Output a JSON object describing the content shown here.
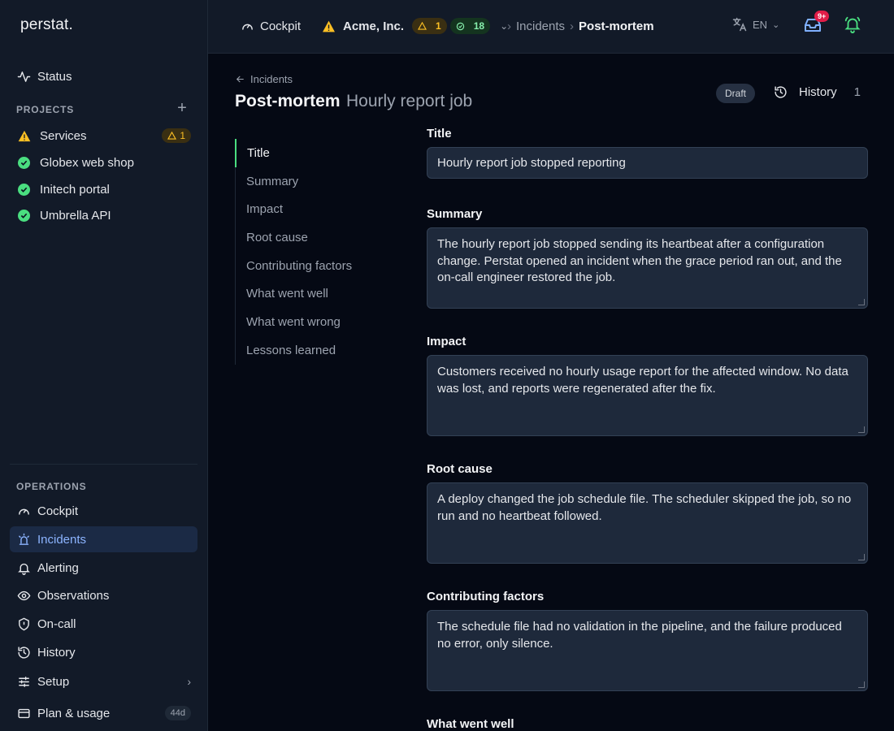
{
  "brand": {
    "logo": "perstat."
  },
  "sidebar": {
    "status_label": "Status",
    "projects_heading": "PROJECTS",
    "projects": [
      {
        "name": "Services",
        "state": "warning",
        "badge": "1"
      },
      {
        "name": "Globex web shop",
        "state": "ok"
      },
      {
        "name": "Initech portal",
        "state": "ok"
      },
      {
        "name": "Umbrella API",
        "state": "ok"
      }
    ],
    "operations_heading": "OPERATIONS",
    "operations": [
      {
        "label": "Cockpit",
        "icon": "gauge-icon"
      },
      {
        "label": "Incidents",
        "icon": "siren-icon",
        "active": true
      },
      {
        "label": "Alerting",
        "icon": "bell-icon"
      },
      {
        "label": "Observations",
        "icon": "eye-icon"
      },
      {
        "label": "On-call",
        "icon": "shield-icon"
      },
      {
        "label": "History",
        "icon": "history-icon"
      },
      {
        "label": "Setup",
        "icon": "sliders-icon"
      },
      {
        "label": "Plan & usage",
        "icon": "card-icon",
        "badge": "44d"
      }
    ]
  },
  "topbar": {
    "cockpit_label": "Cockpit",
    "org_name": "Acme, Inc.",
    "warn_count": "1",
    "ok_count": "18",
    "breadcrumb": [
      "Incidents",
      "Post-mortem"
    ],
    "language": "EN",
    "inbox_badge": "9+"
  },
  "page": {
    "back_label": "Incidents",
    "title": "Post-mortem",
    "subtitle": "Hourly report job",
    "status_badge": "Draft",
    "history_label": "History",
    "history_count": "1"
  },
  "toc": [
    "Title",
    "Summary",
    "Impact",
    "Root cause",
    "Contributing factors",
    "What went well",
    "What went wrong",
    "Lessons learned"
  ],
  "form": {
    "title": {
      "label": "Title",
      "value": "Hourly report job stopped reporting"
    },
    "summary": {
      "label": "Summary",
      "value": "The hourly report job stopped sending its heartbeat after a configuration change. Perstat opened an incident when the grace period ran out, and the on-call engineer restored the job."
    },
    "impact": {
      "label": "Impact",
      "value": "Customers received no hourly usage report for the affected window. No data was lost, and reports were regenerated after the fix."
    },
    "root_cause": {
      "label": "Root cause",
      "value": "A deploy changed the job schedule file. The scheduler skipped the job, so no run and no heartbeat followed."
    },
    "contributing": {
      "label": "Contributing factors",
      "value": "The schedule file had no validation in the pipeline, and the failure produced no error, only silence."
    },
    "went_well": {
      "label": "What went well",
      "value": ""
    }
  },
  "colors": {
    "accent": "#8cb4ff",
    "ok": "#4ade80",
    "warn": "#fbbf24",
    "danger": "#e11d48"
  }
}
